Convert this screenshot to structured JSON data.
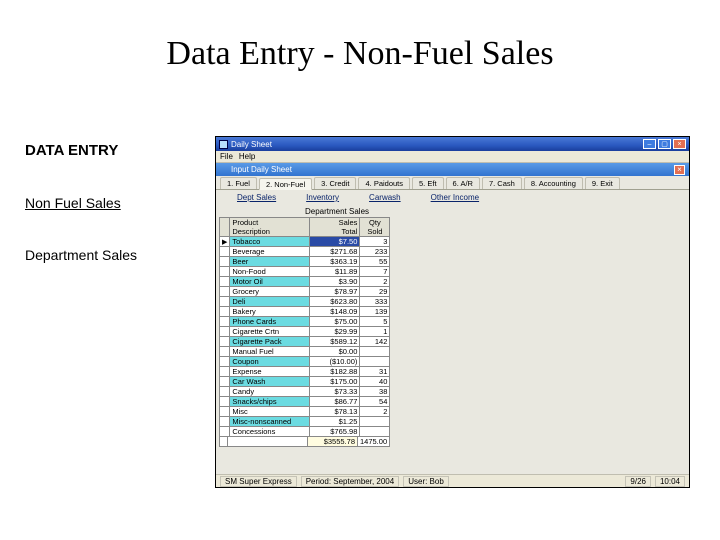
{
  "slide": {
    "title": "Data Entry - Non-Fuel Sales"
  },
  "left": {
    "heading": "DATA ENTRY",
    "link": "Non Fuel Sales",
    "text": "Department Sales"
  },
  "win": {
    "title": "Daily Sheet",
    "menu": [
      "File",
      "Help"
    ],
    "inner_title": "Input Daily Sheet",
    "tabs": [
      "1. Fuel",
      "2. Non-Fuel",
      "3. Credit",
      "4. Paidouts",
      "5. Eft",
      "6. A/R",
      "7. Cash",
      "8. Accounting",
      "9. Exit"
    ],
    "links": [
      "Dept Sales",
      "Inventory",
      "Carwash",
      "Other Income"
    ],
    "section": "Department Sales"
  },
  "grid": {
    "cols": {
      "0a": "Product",
      "0b": "Description",
      "1a": "Sales",
      "1b": "Total",
      "2a": "Qty",
      "2b": "Sold"
    },
    "rows": [
      {
        "desc": "Tobacco",
        "sales": "$7.50",
        "qty": "3",
        "cyan": true,
        "cursor": "▶",
        "selSales": true
      },
      {
        "desc": "Beverage",
        "sales": "$271.68",
        "qty": "233"
      },
      {
        "desc": "Beer",
        "sales": "$363.19",
        "qty": "55",
        "cyan": true
      },
      {
        "desc": "Non-Food",
        "sales": "$11.89",
        "qty": "7"
      },
      {
        "desc": "Motor Oil",
        "sales": "$3.90",
        "qty": "2",
        "cyan": true
      },
      {
        "desc": "Grocery",
        "sales": "$78.97",
        "qty": "29"
      },
      {
        "desc": "Deli",
        "sales": "$623.80",
        "qty": "333",
        "cyan": true
      },
      {
        "desc": "Bakery",
        "sales": "$148.09",
        "qty": "139"
      },
      {
        "desc": "Phone Cards",
        "sales": "$75.00",
        "qty": "5",
        "cyan": true
      },
      {
        "desc": "Cigarette Crtn",
        "sales": "$29.99",
        "qty": "1"
      },
      {
        "desc": "Cigarette Pack",
        "sales": "$589.12",
        "qty": "142",
        "cyan": true
      },
      {
        "desc": "Manual Fuel",
        "sales": "$0.00",
        "qty": ""
      },
      {
        "desc": "Coupon",
        "sales": "($10.00)",
        "qty": "",
        "cyan": true
      },
      {
        "desc": "Expense",
        "sales": "$182.88",
        "qty": "31"
      },
      {
        "desc": "Car Wash",
        "sales": "$175.00",
        "qty": "40",
        "cyan": true
      },
      {
        "desc": "Candy",
        "sales": "$73.33",
        "qty": "38"
      },
      {
        "desc": "Snacks/chips",
        "sales": "$86.77",
        "qty": "54",
        "cyan": true
      },
      {
        "desc": "Misc",
        "sales": "$78.13",
        "qty": "2"
      },
      {
        "desc": "Misc-nonscanned",
        "sales": "$1.25",
        "qty": "",
        "cyan": true
      },
      {
        "desc": "Concessions",
        "sales": "$765.98",
        "qty": ""
      }
    ],
    "totals": {
      "sales": "$3555.78",
      "qty": "1475.00"
    }
  },
  "status": {
    "store": "SM Super Express",
    "period": "Period: September, 2004",
    "user": "User: Bob",
    "date": "9/26",
    "time": "10:04"
  }
}
